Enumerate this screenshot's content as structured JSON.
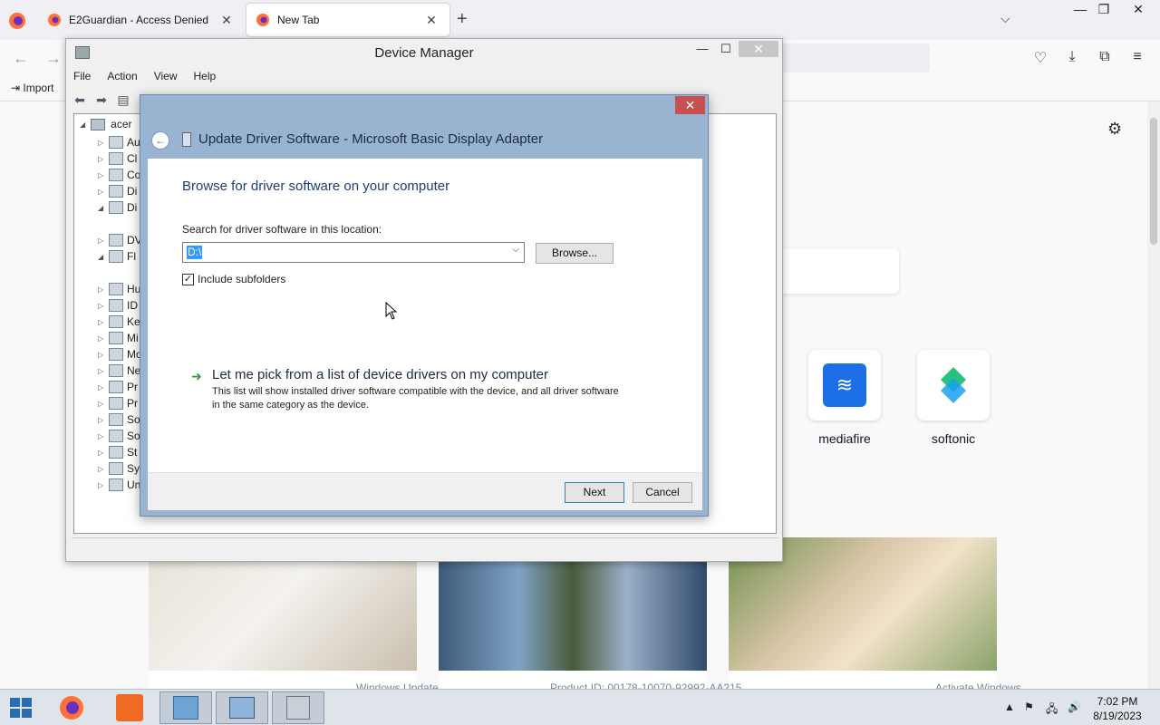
{
  "browser": {
    "tabs": [
      {
        "label": "E2Guardian - Access Denied",
        "active": false
      },
      {
        "label": "New Tab",
        "active": true
      }
    ],
    "bookmarks": {
      "import_label": "Import"
    },
    "shortcuts": [
      {
        "label": "mediafire",
        "icon": "mediafire-logo"
      },
      {
        "label": "softonic",
        "icon": "softonic-logo"
      }
    ]
  },
  "device_manager": {
    "title": "Device Manager",
    "menu": [
      "File",
      "Action",
      "View",
      "Help"
    ],
    "tree_root": "acer",
    "tree_items": [
      "Au",
      "Cl",
      "Co",
      "Di",
      "Di",
      "DV",
      "Fl",
      "Hu",
      "ID",
      "Ke",
      "Mi",
      "Mo",
      "Ne",
      "Pr",
      "Pr",
      "So",
      "So",
      "St",
      "Sy",
      "Un"
    ]
  },
  "wizard": {
    "title": "Update Driver Software - Microsoft Basic Display Adapter",
    "heading": "Browse for driver software on your computer",
    "location_label": "Search for driver software in this location:",
    "location_value": "D:\\",
    "browse_label": "Browse...",
    "include_subfolders_label": "Include subfolders",
    "include_subfolders_checked": true,
    "pick_link": "Let me pick from a list of device drivers on my computer",
    "pick_desc": "This list will show installed driver software compatible with the device, and all driver software in the same category as the device.",
    "next_label": "Next",
    "cancel_label": "Cancel"
  },
  "taskbar": {
    "time": "7:02 PM",
    "date": "8/19/2023",
    "ghost_texts": [
      "Windows Update",
      "Product ID: 00178-10070-92992-AA215",
      "Activate Windows"
    ]
  },
  "colors": {
    "wizard_frame": "#99b4d1",
    "close_red": "#c75050",
    "heading_blue": "#1e3f73",
    "mediafire_blue": "#1d6fe8"
  }
}
